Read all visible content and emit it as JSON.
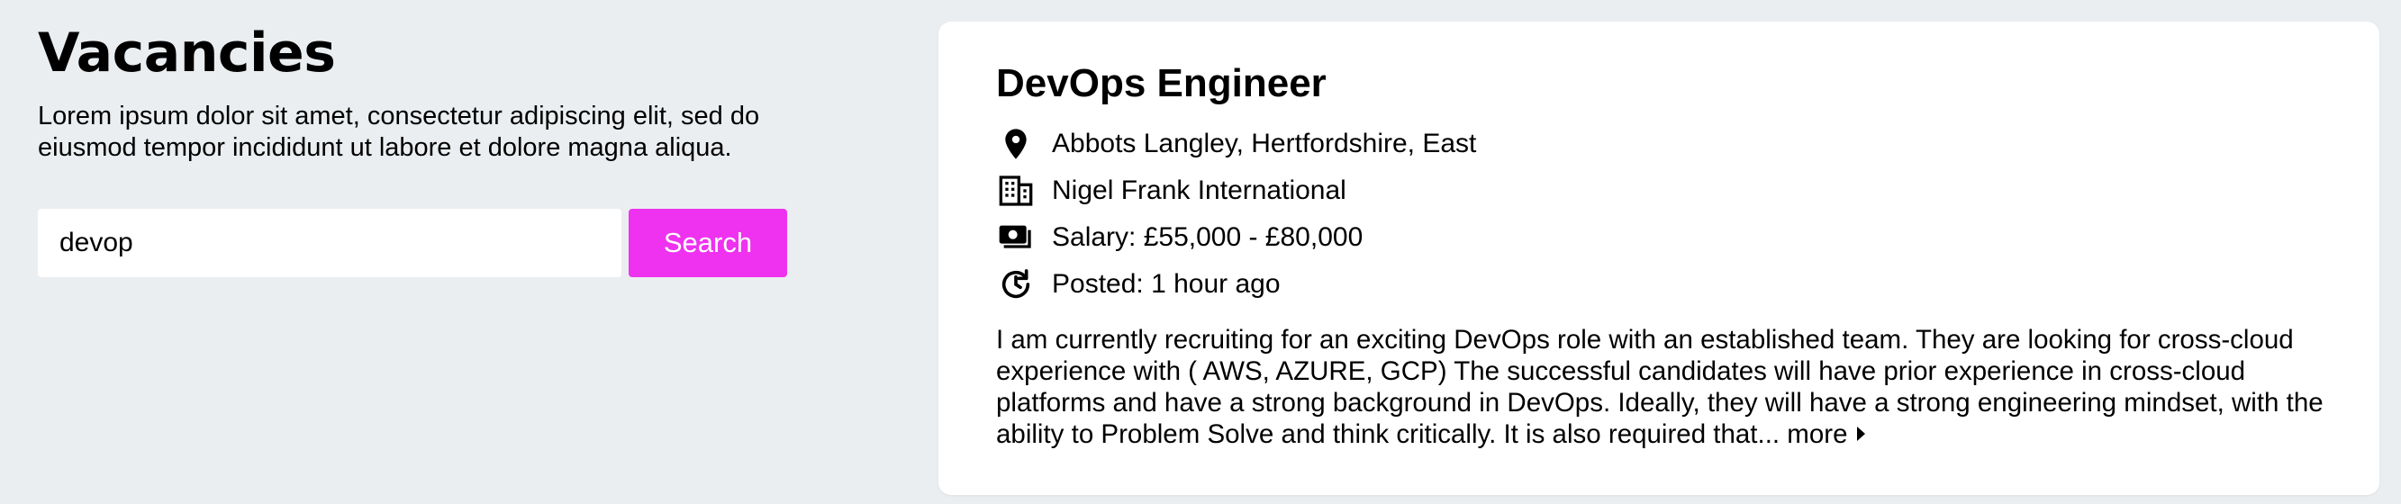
{
  "colors": {
    "page_background": "#ebeef0",
    "card_background": "#ffffff",
    "accent": "#ee32f0"
  },
  "page": {
    "title": "Vacancies",
    "intro": "Lorem ipsum dolor sit amet, consectetur adipiscing elit, sed do eiusmod tempor incididunt ut labore et dolore magna aliqua."
  },
  "search": {
    "value": "devop",
    "placeholder": "",
    "button_label": "Search"
  },
  "job": {
    "title": "DevOps Engineer",
    "location": "Abbots Langley, Hertfordshire, East",
    "company": "Nigel Frank International",
    "salary": "Salary: £55,000 - £80,000",
    "posted": "Posted: 1 hour ago",
    "description": "I am currently recruiting for an exciting DevOps role with an established team. They are looking for cross-cloud experience with ( AWS, AZURE, GCP) The successful candidates will have prior experience in cross-cloud platforms and have a strong background in DevOps. Ideally, they will have a strong engineering mindset, with the ability to Problem Solve and think critically. It is also required that...",
    "more_label": "more",
    "icons": {
      "location": "map-pin-icon",
      "company": "building-icon",
      "salary": "money-icon",
      "posted": "clock-icon",
      "more": "caret-right-icon"
    }
  }
}
